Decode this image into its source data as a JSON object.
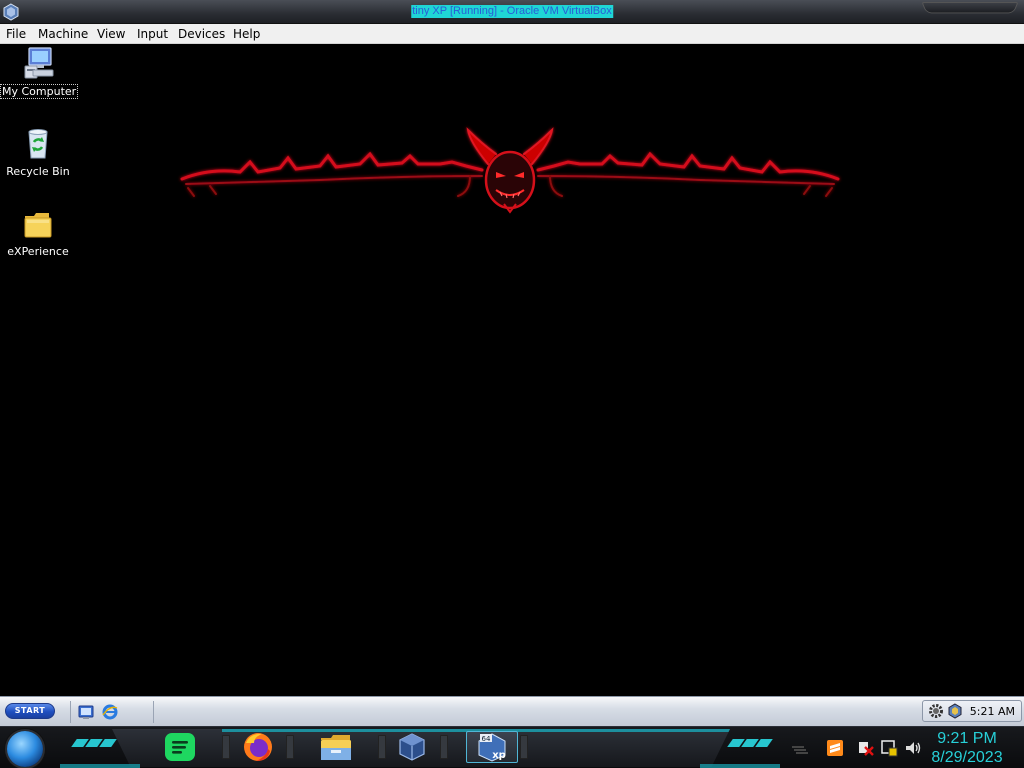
{
  "host_window": {
    "title": "tiny XP [Running] - Oracle VM VirtualBox"
  },
  "menu": {
    "items": [
      "File",
      "Machine",
      "View",
      "Input",
      "Devices",
      "Help"
    ]
  },
  "desktop": {
    "icons": [
      {
        "label": "My Computer",
        "icon": "my-computer-icon",
        "selected": true
      },
      {
        "label": "Recycle Bin",
        "icon": "recycle-bin-icon",
        "selected": false
      },
      {
        "label": "eXPerience",
        "icon": "folder-icon",
        "selected": false
      }
    ],
    "wallpaper": {
      "description_icon": "red-devil-wallpaper",
      "accent": "#d4101a"
    }
  },
  "guest_taskbar": {
    "start_label": "START",
    "quick_launch": [
      "show-desktop-icon",
      "internet-explorer-icon"
    ],
    "tray_icons": [
      "settings-gear-icon",
      "virtualbox-guest-icon"
    ],
    "clock": "5:21 AM"
  },
  "host_dock": {
    "apps": [
      {
        "name": "spotify-icon",
        "active": false
      },
      {
        "name": "firefox-icon",
        "active": false
      },
      {
        "name": "file-explorer-icon",
        "active": false
      },
      {
        "name": "virtualbox-manager-icon",
        "active": false
      },
      {
        "name": "tiny-xp-vm-icon",
        "active": true,
        "badge": "64",
        "caption": "xp"
      }
    ],
    "tray_icons": [
      "sublime-text-icon",
      "network-muted-icon",
      "security-shield-icon",
      "volume-icon"
    ],
    "clock_time": "9:21 PM",
    "clock_date": "8/29/2023"
  },
  "colors": {
    "title_highlight": "#1fd6d6",
    "title_text": "#2a5dd8",
    "dock_accent": "#27c6cf",
    "clock_color": "#27d0d8"
  }
}
